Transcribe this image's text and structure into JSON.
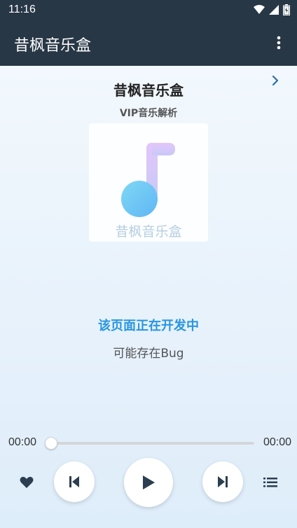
{
  "status": {
    "time": "11:16"
  },
  "app_bar": {
    "title": "昔枫音乐盒"
  },
  "song": {
    "title": "昔枫音乐盒",
    "subtitle": "VIP音乐解析",
    "cover_text": "昔枫音乐盒"
  },
  "notice": {
    "title": "该页面正在开发中",
    "subtitle": "可能存在Bug"
  },
  "player": {
    "current_time": "00:00",
    "total_time": "00:00",
    "progress": 0
  },
  "colors": {
    "app_bar": "#283746",
    "accent": "#2896e1"
  }
}
